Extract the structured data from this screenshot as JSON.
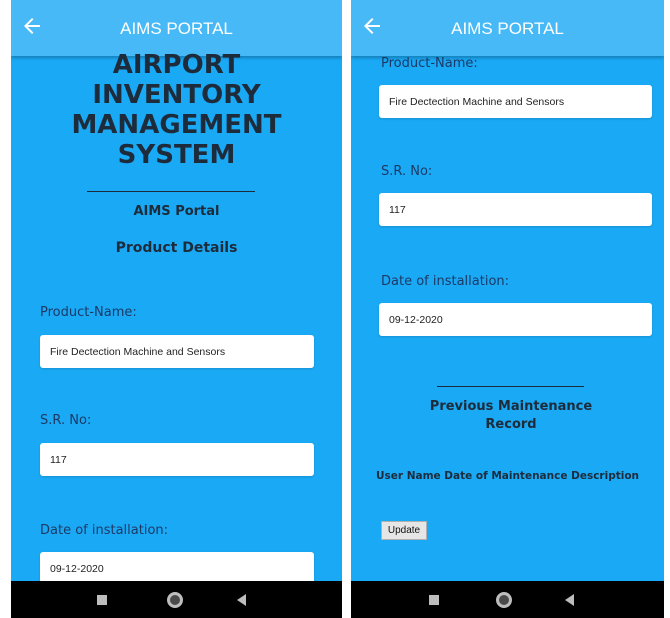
{
  "app": {
    "title": "AIMS PORTAL"
  },
  "left": {
    "system_title_lines": [
      "AIRPORT",
      "INVENTORY",
      "MANAGEMENT",
      "SYSTEM"
    ],
    "subtitle": "AIMS Portal",
    "section_title": "Product Details"
  },
  "form": {
    "product_name_label": "Product-Name:",
    "product_name_value": "Fire Dectection Machine and Sensors",
    "sr_no_label": "S.R. No:",
    "sr_no_value": "117",
    "date_label": "Date of installation:",
    "date_value": "09-12-2020"
  },
  "right": {
    "maintenance_title_line1": "Previous Maintenance",
    "maintenance_title_line2": "Record",
    "table_header": "User Name Date of Maintenance Description",
    "update_button": "Update"
  },
  "icons": {
    "back": "arrow-left-icon",
    "nav_back": "triangle-back-icon",
    "nav_home": "circle-home-icon",
    "nav_recent": "square-recent-icon"
  }
}
